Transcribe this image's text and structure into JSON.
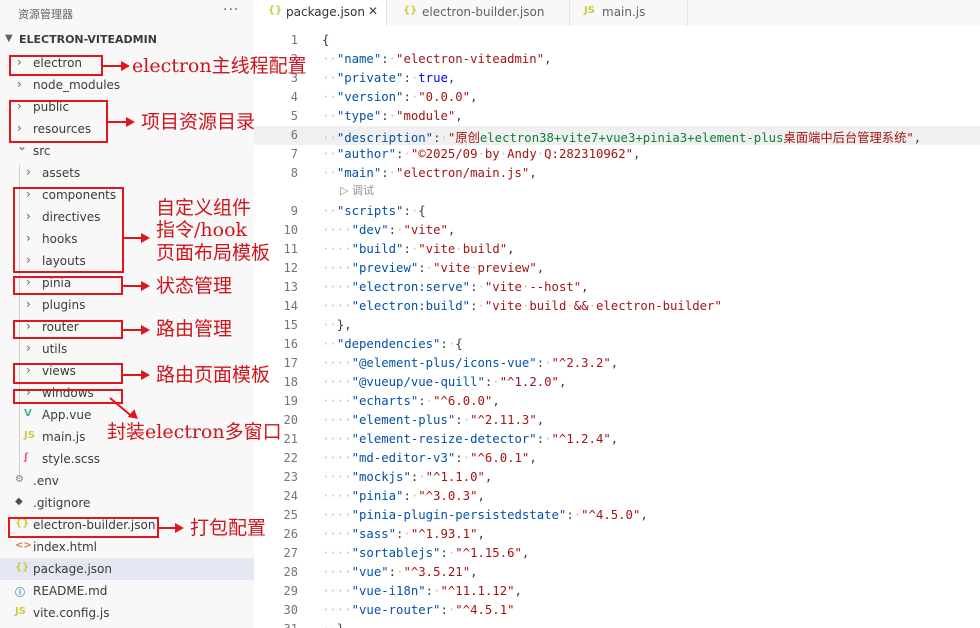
{
  "explorer": {
    "title": "资源管理器",
    "more": "···",
    "project": "ELECTRON-VITEADMIN",
    "items": [
      {
        "label": "electron",
        "kind": "folder"
      },
      {
        "label": "node_modules",
        "kind": "folder"
      },
      {
        "label": "public",
        "kind": "folder"
      },
      {
        "label": "resources",
        "kind": "folder"
      },
      {
        "label": "src",
        "kind": "folder-open"
      },
      {
        "label": "assets",
        "kind": "folder"
      },
      {
        "label": "components",
        "kind": "folder"
      },
      {
        "label": "directives",
        "kind": "folder"
      },
      {
        "label": "hooks",
        "kind": "folder"
      },
      {
        "label": "layouts",
        "kind": "folder"
      },
      {
        "label": "pinia",
        "kind": "folder"
      },
      {
        "label": "plugins",
        "kind": "folder"
      },
      {
        "label": "router",
        "kind": "folder"
      },
      {
        "label": "utils",
        "kind": "folder"
      },
      {
        "label": "views",
        "kind": "folder"
      },
      {
        "label": "windows",
        "kind": "folder"
      },
      {
        "label": "App.vue",
        "kind": "vue",
        "icon": "V"
      },
      {
        "label": "main.js",
        "kind": "js",
        "icon": "JS"
      },
      {
        "label": "style.scss",
        "kind": "scss",
        "icon": "ʃ"
      },
      {
        "label": ".env",
        "kind": "env",
        "icon": "⚙"
      },
      {
        "label": ".gitignore",
        "kind": "git",
        "icon": "◆"
      },
      {
        "label": "electron-builder.json",
        "kind": "json",
        "icon": "{}"
      },
      {
        "label": "index.html",
        "kind": "html",
        "icon": "<>"
      },
      {
        "label": "package.json",
        "kind": "json",
        "icon": "{}"
      },
      {
        "label": "README.md",
        "kind": "md",
        "icon": "ⓘ"
      },
      {
        "label": "vite.config.js",
        "kind": "js",
        "icon": "JS"
      }
    ]
  },
  "tabs": [
    {
      "label": "package.json",
      "icon": "{}",
      "close": "✕"
    },
    {
      "label": "electron-builder.json",
      "icon": "{}"
    },
    {
      "label": "main.js",
      "icon": "JS"
    }
  ],
  "editor": {
    "codelens": "▷ 调试",
    "lines": [
      {
        "n": "1",
        "t": [
          [
            "p",
            "{"
          ]
        ]
      },
      {
        "n": "2",
        "t": [
          [
            "ws",
            "··"
          ],
          [
            "k",
            "\"name\""
          ],
          [
            "p",
            ":"
          ],
          [
            "ws",
            "·"
          ],
          [
            "s",
            "\"electron-viteadmin\""
          ],
          [
            "p",
            ","
          ]
        ]
      },
      {
        "n": "3",
        "t": [
          [
            "ws",
            "··"
          ],
          [
            "k",
            "\"private\""
          ],
          [
            "p",
            ":"
          ],
          [
            "ws",
            "·"
          ],
          [
            "b",
            "true"
          ],
          [
            "p",
            ","
          ]
        ]
      },
      {
        "n": "4",
        "t": [
          [
            "ws",
            "··"
          ],
          [
            "k",
            "\"version\""
          ],
          [
            "p",
            ":"
          ],
          [
            "ws",
            "·"
          ],
          [
            "s",
            "\"0.0.0\""
          ],
          [
            "p",
            ","
          ]
        ]
      },
      {
        "n": "5",
        "t": [
          [
            "ws",
            "··"
          ],
          [
            "k",
            "\"type\""
          ],
          [
            "p",
            ":"
          ],
          [
            "ws",
            "·"
          ],
          [
            "s",
            "\"module\""
          ],
          [
            "p",
            ","
          ]
        ]
      },
      {
        "n": "6",
        "t": [
          [
            "ws",
            "··"
          ],
          [
            "k",
            "\"description\""
          ],
          [
            "p",
            ":"
          ],
          [
            "ws",
            "·"
          ],
          [
            "s",
            "\"原创"
          ],
          [
            "s2",
            "electron38+vite7+vue3+pinia3+element-plus"
          ],
          [
            "s",
            "桌面端中后台管理系统\""
          ],
          [
            "p",
            ","
          ]
        ]
      },
      {
        "n": "7",
        "t": [
          [
            "ws",
            "··"
          ],
          [
            "k",
            "\"author\""
          ],
          [
            "p",
            ":"
          ],
          [
            "ws",
            "·"
          ],
          [
            "s",
            "\"©2025/09"
          ],
          [
            "ws",
            "·"
          ],
          [
            "s",
            "by"
          ],
          [
            "ws",
            "·"
          ],
          [
            "s",
            "Andy"
          ],
          [
            "ws",
            "·"
          ],
          [
            "s",
            "Q:282310962\""
          ],
          [
            "p",
            ","
          ]
        ]
      },
      {
        "n": "8",
        "t": [
          [
            "ws",
            "··"
          ],
          [
            "k",
            "\"main\""
          ],
          [
            "p",
            ":"
          ],
          [
            "ws",
            "·"
          ],
          [
            "s",
            "\"electron/main.js\""
          ],
          [
            "p",
            ","
          ]
        ]
      },
      {
        "n": "9",
        "t": [
          [
            "ws",
            "··"
          ],
          [
            "k",
            "\"scripts\""
          ],
          [
            "p",
            ":"
          ],
          [
            "ws",
            "·"
          ],
          [
            "p",
            "{"
          ]
        ]
      },
      {
        "n": "10",
        "t": [
          [
            "ws",
            "····"
          ],
          [
            "k",
            "\"dev\""
          ],
          [
            "p",
            ":"
          ],
          [
            "ws",
            "·"
          ],
          [
            "s",
            "\"vite\""
          ],
          [
            "p",
            ","
          ]
        ]
      },
      {
        "n": "11",
        "t": [
          [
            "ws",
            "····"
          ],
          [
            "k",
            "\"build\""
          ],
          [
            "p",
            ":"
          ],
          [
            "ws",
            "·"
          ],
          [
            "s",
            "\"vite"
          ],
          [
            "ws",
            "·"
          ],
          [
            "s",
            "build\""
          ],
          [
            "p",
            ","
          ]
        ]
      },
      {
        "n": "12",
        "t": [
          [
            "ws",
            "····"
          ],
          [
            "k",
            "\"preview\""
          ],
          [
            "p",
            ":"
          ],
          [
            "ws",
            "·"
          ],
          [
            "s",
            "\"vite"
          ],
          [
            "ws",
            "·"
          ],
          [
            "s",
            "preview\""
          ],
          [
            "p",
            ","
          ]
        ]
      },
      {
        "n": "13",
        "t": [
          [
            "ws",
            "····"
          ],
          [
            "k",
            "\"electron:serve\""
          ],
          [
            "p",
            ":"
          ],
          [
            "ws",
            "·"
          ],
          [
            "s",
            "\"vite"
          ],
          [
            "ws",
            "·"
          ],
          [
            "s",
            "--host\""
          ],
          [
            "p",
            ","
          ]
        ]
      },
      {
        "n": "14",
        "t": [
          [
            "ws",
            "····"
          ],
          [
            "k",
            "\"electron:build\""
          ],
          [
            "p",
            ":"
          ],
          [
            "ws",
            "·"
          ],
          [
            "s",
            "\"vite"
          ],
          [
            "ws",
            "·"
          ],
          [
            "s",
            "build"
          ],
          [
            "ws",
            "·"
          ],
          [
            "s",
            "&&"
          ],
          [
            "ws",
            "·"
          ],
          [
            "s",
            "electron-builder\""
          ]
        ]
      },
      {
        "n": "15",
        "t": [
          [
            "ws",
            "··"
          ],
          [
            "p",
            "},"
          ]
        ]
      },
      {
        "n": "16",
        "t": [
          [
            "ws",
            "··"
          ],
          [
            "k",
            "\"dependencies\""
          ],
          [
            "p",
            ":"
          ],
          [
            "ws",
            "·"
          ],
          [
            "p",
            "{"
          ]
        ]
      },
      {
        "n": "17",
        "t": [
          [
            "ws",
            "····"
          ],
          [
            "k",
            "\"@element-plus/icons-vue\""
          ],
          [
            "p",
            ":"
          ],
          [
            "ws",
            "·"
          ],
          [
            "s",
            "\"^2.3.2\""
          ],
          [
            "p",
            ","
          ]
        ]
      },
      {
        "n": "18",
        "t": [
          [
            "ws",
            "····"
          ],
          [
            "k",
            "\"@vueup/vue-quill\""
          ],
          [
            "p",
            ":"
          ],
          [
            "ws",
            "·"
          ],
          [
            "s",
            "\"^1.2.0\""
          ],
          [
            "p",
            ","
          ]
        ]
      },
      {
        "n": "19",
        "t": [
          [
            "ws",
            "····"
          ],
          [
            "k",
            "\"echarts\""
          ],
          [
            "p",
            ":"
          ],
          [
            "ws",
            "·"
          ],
          [
            "s",
            "\"^6.0.0\""
          ],
          [
            "p",
            ","
          ]
        ]
      },
      {
        "n": "20",
        "t": [
          [
            "ws",
            "····"
          ],
          [
            "k",
            "\"element-plus\""
          ],
          [
            "p",
            ":"
          ],
          [
            "ws",
            "·"
          ],
          [
            "s",
            "\"^2.11.3\""
          ],
          [
            "p",
            ","
          ]
        ]
      },
      {
        "n": "21",
        "t": [
          [
            "ws",
            "····"
          ],
          [
            "k",
            "\"element-resize-detector\""
          ],
          [
            "p",
            ":"
          ],
          [
            "ws",
            "·"
          ],
          [
            "s",
            "\"^1.2.4\""
          ],
          [
            "p",
            ","
          ]
        ]
      },
      {
        "n": "22",
        "t": [
          [
            "ws",
            "····"
          ],
          [
            "k",
            "\"md-editor-v3\""
          ],
          [
            "p",
            ":"
          ],
          [
            "ws",
            "·"
          ],
          [
            "s",
            "\"^6.0.1\""
          ],
          [
            "p",
            ","
          ]
        ]
      },
      {
        "n": "23",
        "t": [
          [
            "ws",
            "····"
          ],
          [
            "k",
            "\"mockjs\""
          ],
          [
            "p",
            ":"
          ],
          [
            "ws",
            "·"
          ],
          [
            "s",
            "\"^1.1.0\""
          ],
          [
            "p",
            ","
          ]
        ]
      },
      {
        "n": "24",
        "t": [
          [
            "ws",
            "····"
          ],
          [
            "k",
            "\"pinia\""
          ],
          [
            "p",
            ":"
          ],
          [
            "ws",
            "·"
          ],
          [
            "s",
            "\"^3.0.3\""
          ],
          [
            "p",
            ","
          ]
        ]
      },
      {
        "n": "25",
        "t": [
          [
            "ws",
            "····"
          ],
          [
            "k",
            "\"pinia-plugin-persistedstate\""
          ],
          [
            "p",
            ":"
          ],
          [
            "ws",
            "·"
          ],
          [
            "s",
            "\"^4.5.0\""
          ],
          [
            "p",
            ","
          ]
        ]
      },
      {
        "n": "26",
        "t": [
          [
            "ws",
            "····"
          ],
          [
            "k",
            "\"sass\""
          ],
          [
            "p",
            ":"
          ],
          [
            "ws",
            "·"
          ],
          [
            "s",
            "\"^1.93.1\""
          ],
          [
            "p",
            ","
          ]
        ]
      },
      {
        "n": "27",
        "t": [
          [
            "ws",
            "····"
          ],
          [
            "k",
            "\"sortablejs\""
          ],
          [
            "p",
            ":"
          ],
          [
            "ws",
            "·"
          ],
          [
            "s",
            "\"^1.15.6\""
          ],
          [
            "p",
            ","
          ]
        ]
      },
      {
        "n": "28",
        "t": [
          [
            "ws",
            "····"
          ],
          [
            "k",
            "\"vue\""
          ],
          [
            "p",
            ":"
          ],
          [
            "ws",
            "·"
          ],
          [
            "s",
            "\"^3.5.21\""
          ],
          [
            "p",
            ","
          ]
        ]
      },
      {
        "n": "29",
        "t": [
          [
            "ws",
            "····"
          ],
          [
            "k",
            "\"vue-i18n\""
          ],
          [
            "p",
            ":"
          ],
          [
            "ws",
            "·"
          ],
          [
            "s",
            "\"^11.1.12\""
          ],
          [
            "p",
            ","
          ]
        ]
      },
      {
        "n": "30",
        "t": [
          [
            "ws",
            "····"
          ],
          [
            "k",
            "\"vue-router\""
          ],
          [
            "p",
            ":"
          ],
          [
            "ws",
            "·"
          ],
          [
            "s",
            "\"^4.5.1\""
          ]
        ]
      },
      {
        "n": "31",
        "t": [
          [
            "ws",
            "··"
          ],
          [
            "p",
            "},"
          ]
        ]
      }
    ]
  },
  "annotations": [
    {
      "id": "electron",
      "text": "electron主线程配置"
    },
    {
      "id": "resources",
      "text": "项目资源目录"
    },
    {
      "id": "components",
      "text": "自定义组件"
    },
    {
      "id": "directives",
      "text": "指令/hook"
    },
    {
      "id": "layouts",
      "text": "页面布局模板"
    },
    {
      "id": "pinia",
      "text": "状态管理"
    },
    {
      "id": "router",
      "text": "路由管理"
    },
    {
      "id": "views",
      "text": "路由页面模板"
    },
    {
      "id": "windows",
      "text": "封装electron多窗口"
    },
    {
      "id": "builder",
      "text": "打包配置"
    }
  ],
  "colors": {
    "annotation": "#e0161e",
    "selected_row": "#e4e6f1",
    "json_key": "#0451a5",
    "json_string": "#a31515"
  }
}
